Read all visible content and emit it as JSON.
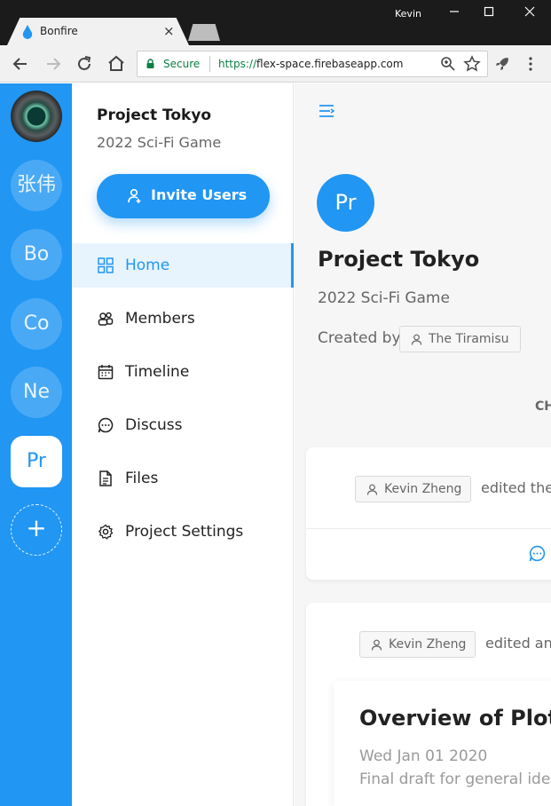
{
  "browser": {
    "tab_title": "Bonfire",
    "tab_close": "×",
    "window_user": "Kevin",
    "secure_label": "Secure",
    "url_protocol": "https://",
    "url_host": "flex-space.firebaseapp.com"
  },
  "workspaces": [
    {
      "label": "张伟"
    },
    {
      "label": "Bo"
    },
    {
      "label": "Co"
    },
    {
      "label": "Ne"
    },
    {
      "label": "Pr",
      "active": true
    }
  ],
  "add_workspace": "+",
  "sidebar": {
    "project_title": "Project Tokyo",
    "project_subtitle": "2022 Sci-Fi Game",
    "invite_label": "Invite Users",
    "nav": [
      {
        "label": "Home",
        "icon": "grid-icon",
        "active": true
      },
      {
        "label": "Members",
        "icon": "members-icon"
      },
      {
        "label": "Timeline",
        "icon": "calendar-icon"
      },
      {
        "label": "Discuss",
        "icon": "chat-icon"
      },
      {
        "label": "Files",
        "icon": "file-icon"
      },
      {
        "label": "Project Settings",
        "icon": "gear-icon"
      }
    ]
  },
  "main": {
    "avatar_initials": "Pr",
    "title": "Project Tokyo",
    "subtitle": "2022 Sci-Fi Game",
    "created_by_label": "Created by",
    "creator": "The Tiramisu",
    "clipped_label": "CH",
    "feed": [
      {
        "user": "Kevin Zheng",
        "action": "edited the"
      },
      {
        "user": "Kevin Zheng",
        "action": "edited an"
      }
    ],
    "doc": {
      "title": "Overview of Plot",
      "date": "Wed Jan 01 2020",
      "description": "Final draft for general idea"
    }
  },
  "colors": {
    "accent": "#2196f3",
    "rail": "#2196f3",
    "active_nav_bg": "#e7f4fe"
  }
}
